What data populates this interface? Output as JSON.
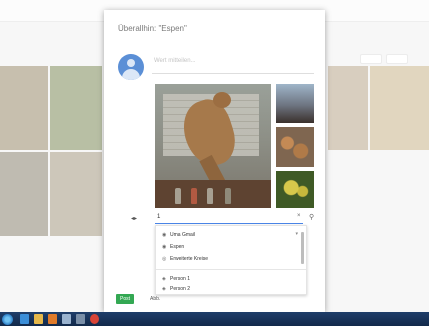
{
  "dialog": {
    "title": "Überallhin: \"Espen\"",
    "comment_placeholder": "Wert mitteilen...",
    "share_input_value": "1",
    "clear_glyph": "×",
    "post_label": "Post",
    "cancel_label": "Abb."
  },
  "dropdown": {
    "items": [
      {
        "label": "Uma Gmail",
        "icon": "people-icon"
      },
      {
        "label": "Espen",
        "icon": "circle-icon"
      },
      {
        "label": "Erweiterte Kreise",
        "icon": "circles-icon"
      },
      {
        "label": "Person 1",
        "icon": "person-icon"
      },
      {
        "label": "Person 2",
        "icon": "person-icon"
      }
    ]
  },
  "colors": {
    "accent": "#4a86e8",
    "post_button": "#33a853",
    "taskbar": "#12294a",
    "avatar": "#5b8fd6"
  },
  "taskbar": {
    "icons": [
      "start-icon",
      "ie-icon",
      "folder-icon",
      "media-icon",
      "explorer-icon",
      "app-icon",
      "chrome-icon"
    ]
  }
}
